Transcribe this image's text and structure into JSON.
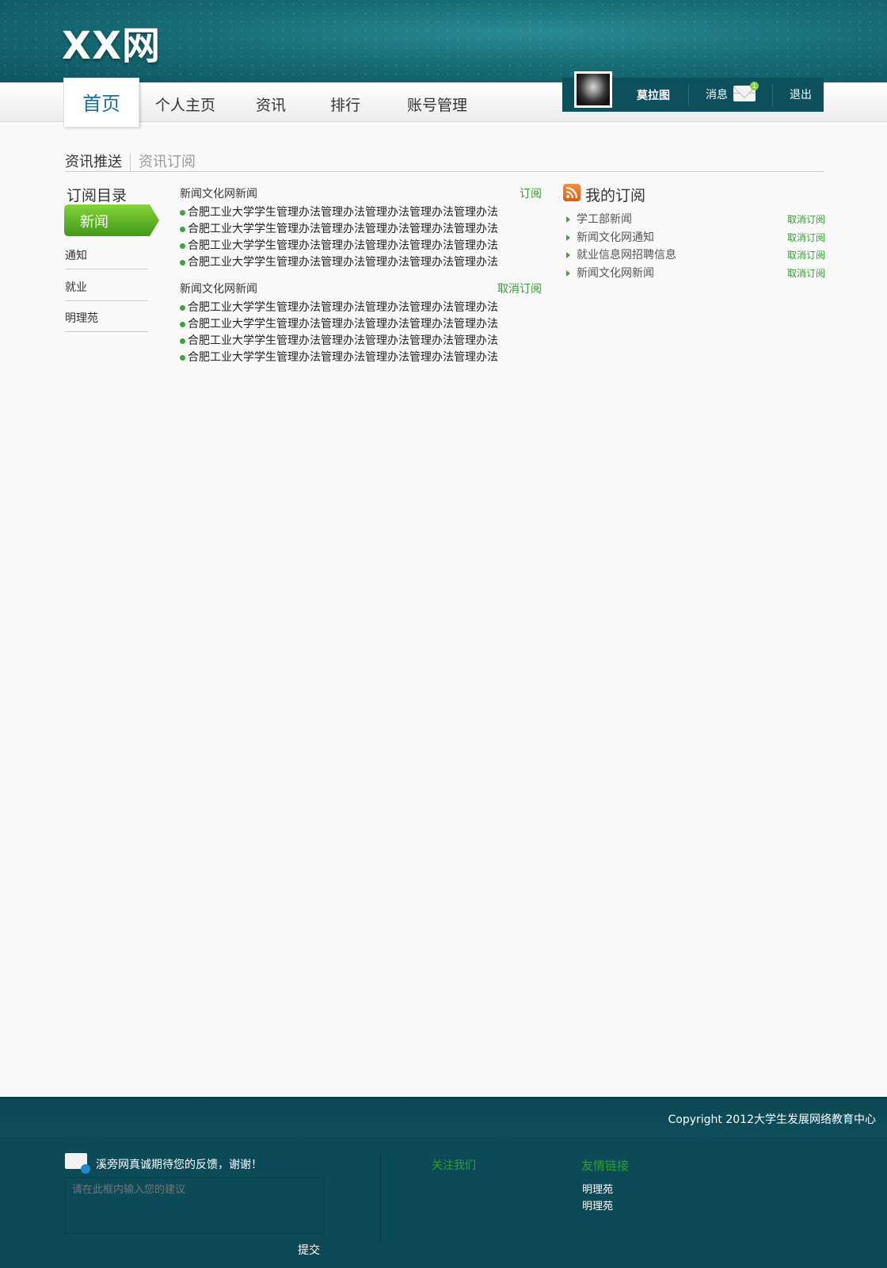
{
  "header": {
    "logo": "XX网"
  },
  "nav": {
    "items": [
      {
        "label": "首页"
      },
      {
        "label": "个人主页"
      },
      {
        "label": "资讯"
      },
      {
        "label": "排行"
      },
      {
        "label": "账号管理"
      }
    ]
  },
  "user": {
    "name": "莫拉图",
    "messages_label": "消息",
    "unread_count": "1",
    "logout_label": "退出"
  },
  "section_tabs": {
    "active": "资讯推送",
    "inactive": "资讯订阅"
  },
  "sidebar": {
    "title": "订阅目录",
    "active_item": "新闻",
    "items": [
      {
        "label": "通知"
      },
      {
        "label": "就业"
      },
      {
        "label": "明理苑"
      }
    ]
  },
  "feeds": [
    {
      "source": "新闻文化网新闻",
      "action": "订阅",
      "items": [
        "合肥工业大学学生管理办法管理办法管理办法管理办法管理办法",
        "合肥工业大学学生管理办法管理办法管理办法管理办法管理办法",
        "合肥工业大学学生管理办法管理办法管理办法管理办法管理办法",
        "合肥工业大学学生管理办法管理办法管理办法管理办法管理办法"
      ]
    },
    {
      "source": "新闻文化网新闻",
      "action": "取消订阅",
      "items": [
        "合肥工业大学学生管理办法管理办法管理办法管理办法管理办法",
        "合肥工业大学学生管理办法管理办法管理办法管理办法管理办法",
        "合肥工业大学学生管理办法管理办法管理办法管理办法管理办法",
        "合肥工业大学学生管理办法管理办法管理办法管理办法管理办法"
      ]
    }
  ],
  "my_subscriptions": {
    "title": "我的订阅",
    "unsubscribe_label": "取消订阅",
    "items": [
      {
        "label": "学工部新闻"
      },
      {
        "label": "新闻文化网通知"
      },
      {
        "label": "就业信息网招聘信息"
      },
      {
        "label": "新闻文化网新闻"
      }
    ]
  },
  "footer": {
    "copyright": "Copyright    2012大学生发展网络教育中心",
    "feedback_text": "溪旁网真诚期待您的反馈，谢谢！",
    "feedback_placeholder": "请在此框内输入您的建议",
    "submit_label": "提交",
    "follow_title": "关注我们",
    "links_title": "友情链接",
    "links": [
      {
        "label": "明理苑"
      },
      {
        "label": "明理苑"
      }
    ]
  },
  "colors": {
    "accent_green": "#2da02d",
    "header_teal": "#176d76",
    "footer_teal": "#0d4a57",
    "link_blue": "#1a6fa0"
  }
}
